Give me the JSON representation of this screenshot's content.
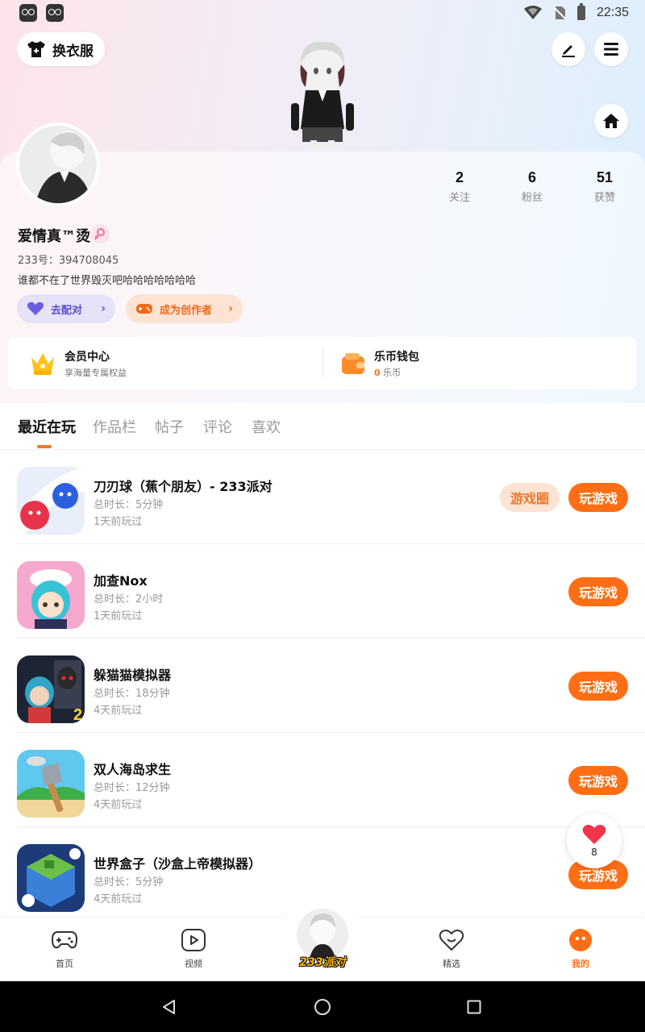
{
  "status_bar": {
    "time": "22:35"
  },
  "header": {
    "outfit_label": "换衣服"
  },
  "profile": {
    "username": "爱情真™烫",
    "uid": "233号：394708045",
    "bio": "谁都不在了世界毁灭吧哈哈哈哈哈哈哈",
    "stats": [
      {
        "value": "2",
        "label": "关注"
      },
      {
        "value": "6",
        "label": "粉丝"
      },
      {
        "value": "51",
        "label": "获赞"
      }
    ],
    "match_label": "去配对",
    "creator_label": "成为创作者"
  },
  "vip": {
    "member_title": "会员中心",
    "member_sub": "享海量专属权益",
    "wallet_title": "乐币钱包",
    "wallet_amount": "0",
    "wallet_unit": "乐币"
  },
  "tabs": [
    {
      "label": "最近在玩",
      "active": true
    },
    {
      "label": "作品栏"
    },
    {
      "label": "帖子"
    },
    {
      "label": "评论"
    },
    {
      "label": "喜欢"
    }
  ],
  "games": [
    {
      "title": "刀刃球（蕉个朋友）- 233派对",
      "duration": "总时长：5分钟",
      "last": "1天前玩过",
      "circle_label": "游戏圈",
      "play_label": "玩游戏"
    },
    {
      "title": "加查Nox",
      "duration": "总时长：2小时",
      "last": "1天前玩过",
      "play_label": "玩游戏"
    },
    {
      "title": "躲猫猫模拟器",
      "duration": "总时长：18分钟",
      "last": "4天前玩过",
      "play_label": "玩游戏"
    },
    {
      "title": "双人海岛求生",
      "duration": "总时长：12分钟",
      "last": "4天前玩过",
      "play_label": "玩游戏"
    },
    {
      "title": "世界盒子（沙盒上帝模拟器）",
      "duration": "总时长：5分钟",
      "last": "4天前玩过",
      "play_label": "玩游戏"
    }
  ],
  "like_float": {
    "count": "8"
  },
  "bottom_nav": {
    "home": "首页",
    "video": "视频",
    "center_brand": "233派对",
    "featured": "精选",
    "mine": "我的"
  },
  "colors": {
    "accent": "#ff6e14",
    "match_purple": "#5a4fc9"
  }
}
